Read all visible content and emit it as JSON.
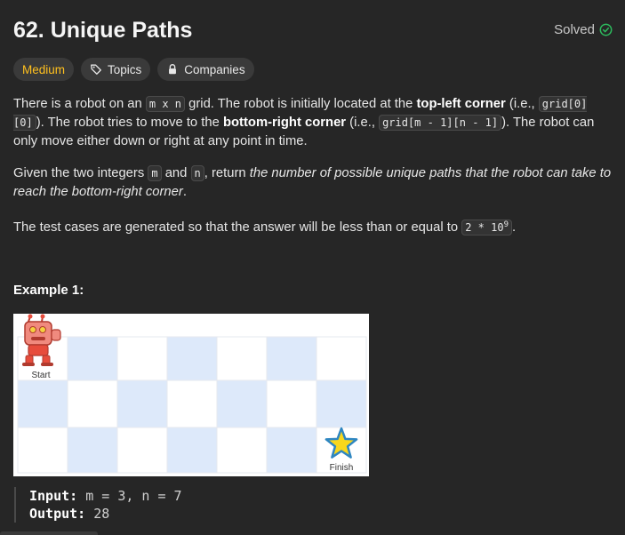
{
  "problem": {
    "title": "62. Unique Paths",
    "solved_label": "Solved",
    "tags": {
      "difficulty": "Medium",
      "topics": "Topics",
      "companies": "Companies"
    }
  },
  "description": {
    "p1": {
      "t1": "There is a robot on an ",
      "c1": "m x n",
      "t2": " grid. The robot is initially located at the ",
      "b1": "top-left corner",
      "t3": " (i.e., ",
      "c2": "grid[0][0]",
      "t4": "). The robot tries to move to the ",
      "b2": "bottom-right corner",
      "t5": " (i.e., ",
      "c3": "grid[m - 1][n - 1]",
      "t6": "). The robot can only move either down or right at any point in time."
    },
    "p2": {
      "t1": "Given the two integers ",
      "c1": "m",
      "t2": " and ",
      "c2": "n",
      "t3": ", return ",
      "i1": "the number of possible unique paths that the robot can take to reach the bottom-right corner",
      "t4": "."
    },
    "p3": {
      "t1": "The test cases are generated so that the answer will be less than or equal to ",
      "c1": "2 * 10",
      "sup": "9",
      "t2": "."
    }
  },
  "example": {
    "title": "Example 1:",
    "grid_labels": {
      "start": "Start",
      "finish": "Finish"
    },
    "input_label": "Input:",
    "input_value": " m = 3, n = 7",
    "output_label": "Output:",
    "output_value": " 28"
  },
  "colors": {
    "difficulty_medium": "#ffc01e",
    "solved_check": "#2cbb5d",
    "grid_blue": "#dde9fa"
  }
}
